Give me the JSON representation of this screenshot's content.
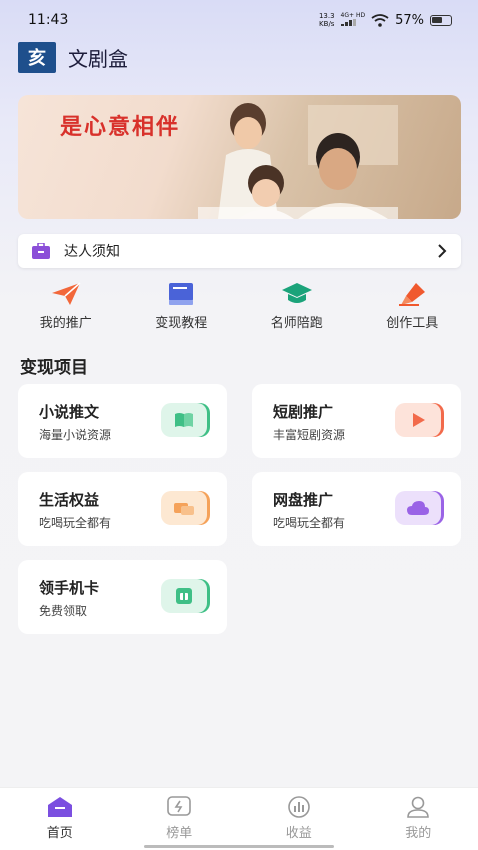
{
  "status": {
    "time": "11:43",
    "speed_top": "13.3",
    "speed_unit": "KB/s",
    "network": "4G+ HD",
    "battery": "57%"
  },
  "header": {
    "logo_text": "亥",
    "title": "文剧盒"
  },
  "banner": {
    "text": "是心意相伴"
  },
  "notice": {
    "label": "达人须知"
  },
  "quick": [
    {
      "label": "我的推广",
      "icon": "paper-plane-icon",
      "color": "#f2673a"
    },
    {
      "label": "变现教程",
      "icon": "book-icon",
      "color": "#4a63d8"
    },
    {
      "label": "名师陪跑",
      "icon": "graduation-cap-icon",
      "color": "#1ba37a"
    },
    {
      "label": "创作工具",
      "icon": "pen-nib-icon",
      "color": "#f0592e"
    }
  ],
  "section": {
    "title": "变现项目"
  },
  "projects": [
    {
      "title": "小说推文",
      "sub": "海量小说资源",
      "icon": "book-open-icon",
      "color": "#3fbf86"
    },
    {
      "title": "短剧推广",
      "sub": "丰富短剧资源",
      "icon": "play-icon",
      "color": "#f26a4b"
    },
    {
      "title": "生活权益",
      "sub": "吃喝玩全都有",
      "icon": "ticket-icon",
      "color": "#f5a25a"
    },
    {
      "title": "网盘推广",
      "sub": "吃喝玩全都有",
      "icon": "cloud-icon",
      "color": "#9a63e6"
    },
    {
      "title": "领手机卡",
      "sub": "免费领取",
      "icon": "sim-card-icon",
      "color": "#3fbf86"
    }
  ],
  "tabs": [
    {
      "label": "首页",
      "icon": "home-icon"
    },
    {
      "label": "榜单",
      "icon": "ranking-icon"
    },
    {
      "label": "收益",
      "icon": "earnings-icon"
    },
    {
      "label": "我的",
      "icon": "profile-icon"
    }
  ]
}
